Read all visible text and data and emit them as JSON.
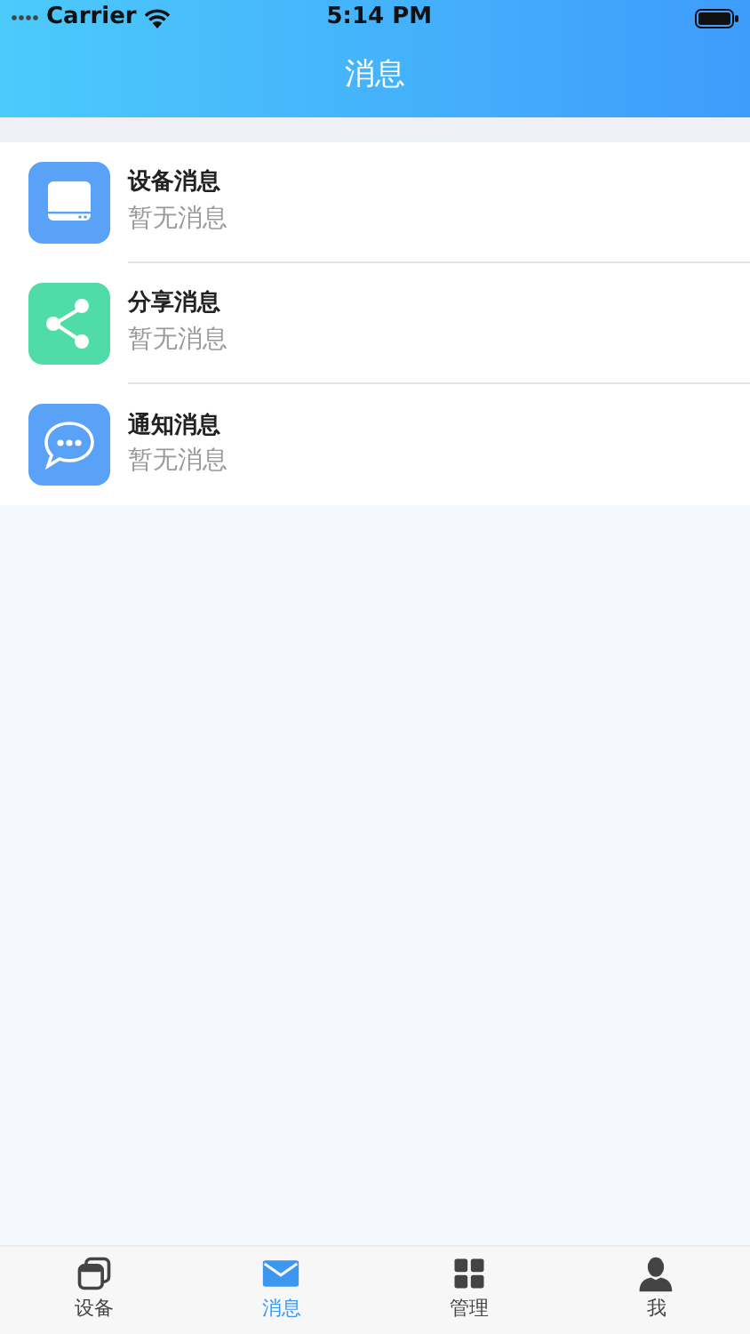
{
  "status_bar": {
    "carrier": "Carrier",
    "time": "5:14 PM"
  },
  "title": "消息",
  "messages": [
    {
      "kind": "device",
      "color": "#5aa2f7",
      "title": "设备消息",
      "subtitle": "暂无消息"
    },
    {
      "kind": "share",
      "color": "#4fdca8",
      "title": "分享消息",
      "subtitle": "暂无消息"
    },
    {
      "kind": "notice",
      "color": "#5aa2f7",
      "title": "通知消息",
      "subtitle": "暂无消息"
    }
  ],
  "tabs": [
    {
      "kind": "devices",
      "label": "设备",
      "selected": false
    },
    {
      "kind": "messages",
      "label": "消息",
      "selected": true
    },
    {
      "kind": "manage",
      "label": "管理",
      "selected": false
    },
    {
      "kind": "me",
      "label": "我",
      "selected": false
    }
  ]
}
